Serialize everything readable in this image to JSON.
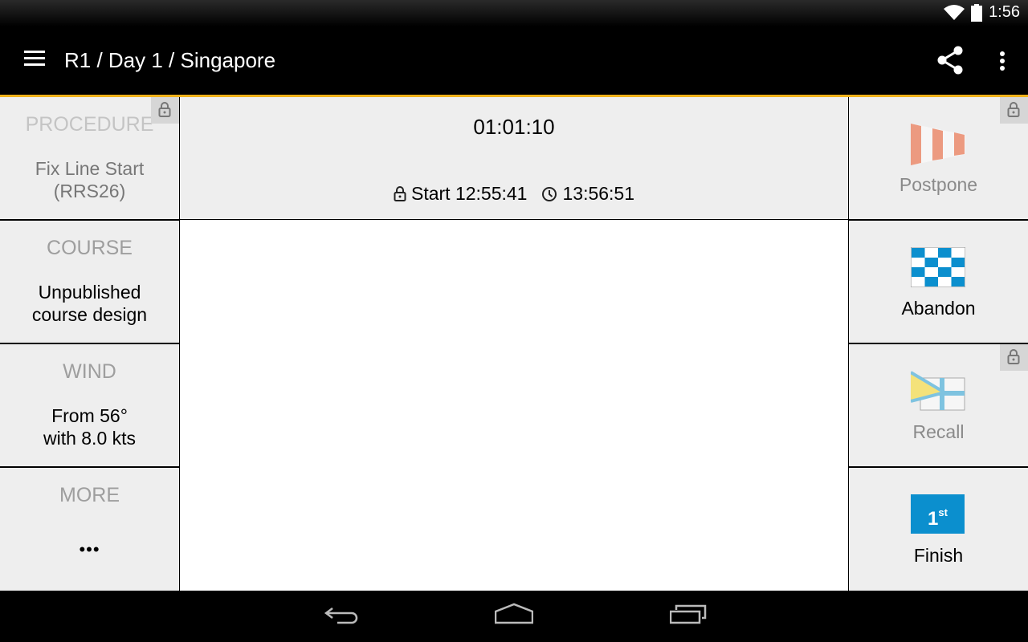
{
  "status_bar": {
    "time": "1:56",
    "icons": [
      "wifi-icon",
      "battery-icon"
    ]
  },
  "app_bar": {
    "title": "R1 / Day 1 / Singapore",
    "menu_icon": "hamburger-menu-icon",
    "actions": [
      "share-icon",
      "overflow-menu-icon"
    ],
    "accent_color": "#f0b21a"
  },
  "left_panel": [
    {
      "heading": "PROCEDURE",
      "value_line1": "Fix Line Start",
      "value_line2": "(RRS26)",
      "locked": true
    },
    {
      "heading": "COURSE",
      "value_line1": "Unpublished",
      "value_line2": "course design",
      "locked": false
    },
    {
      "heading": "WIND",
      "value_line1": "From 56°",
      "value_line2": "with 8.0 kts",
      "locked": false
    },
    {
      "heading": "MORE",
      "value_line1": "•••",
      "value_line2": "",
      "locked": false
    }
  ],
  "timer": {
    "elapsed": "01:01:10",
    "start_label": "Start 12:55:41",
    "current_time": "13:56:51"
  },
  "right_panel": [
    {
      "label": "Postpone",
      "flag": "postpone-flag-icon",
      "locked": true,
      "enabled": false
    },
    {
      "label": "Abandon",
      "flag": "abandon-flag-icon",
      "locked": false,
      "enabled": true
    },
    {
      "label": "Recall",
      "flag": "recall-flag-icon",
      "locked": true,
      "enabled": false
    },
    {
      "label": "Finish",
      "flag": "finish-flag-icon",
      "flag_text": "1",
      "flag_sup": "st",
      "locked": false,
      "enabled": true
    }
  ],
  "colors": {
    "postpone": "#ec9a80",
    "abandon": "#0b8fce",
    "recall_yellow": "#f4e27a",
    "recall_blue": "#7ec3e0",
    "finish": "#0b8fce"
  },
  "nav_bar": [
    "back-icon",
    "home-icon",
    "recents-icon"
  ]
}
